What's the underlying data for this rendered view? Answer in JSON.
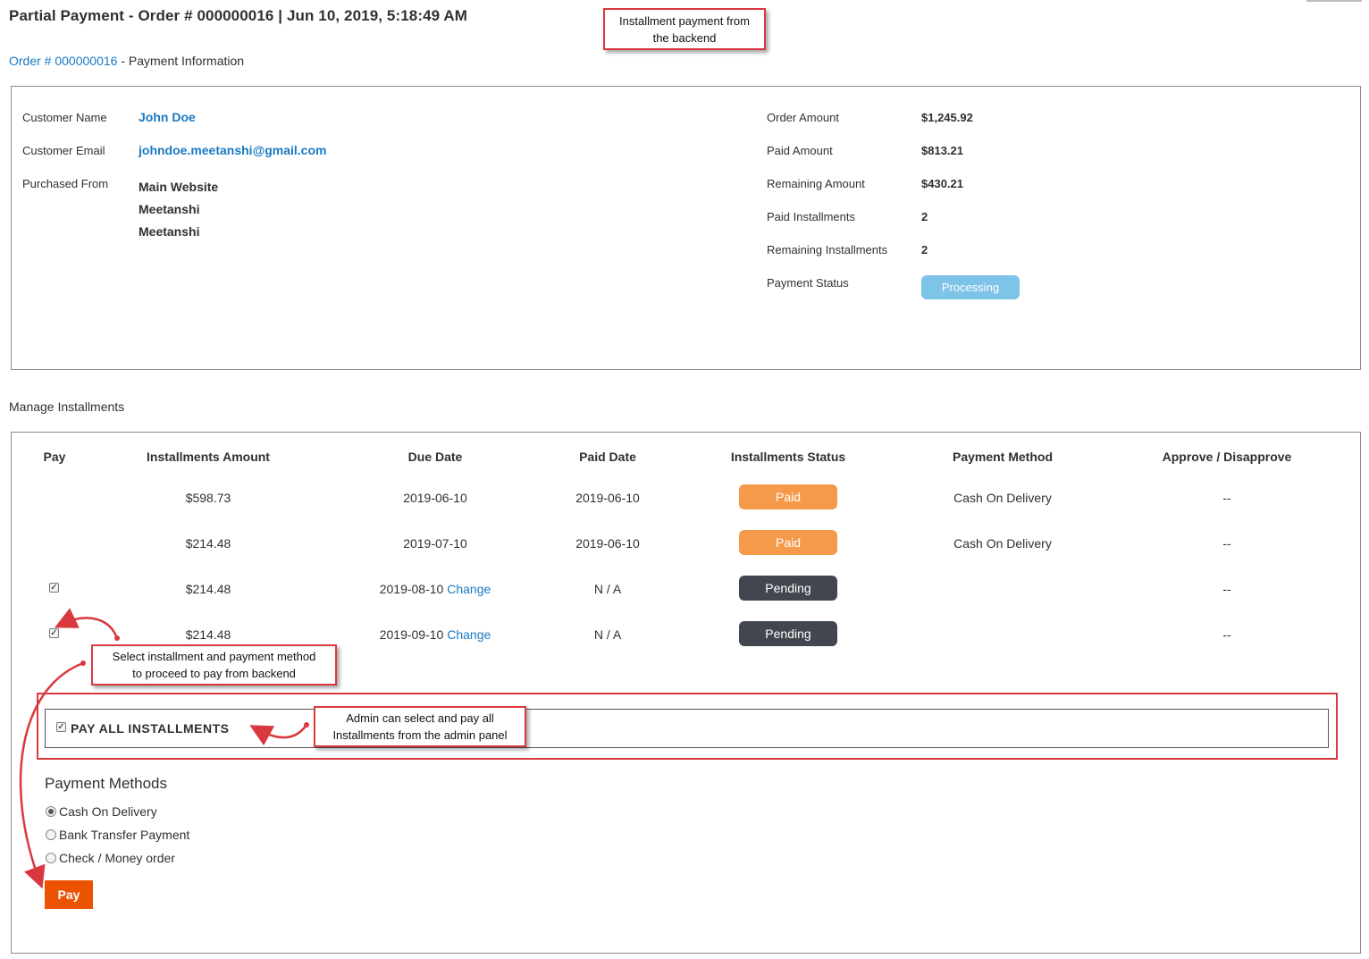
{
  "header": {
    "title": "Partial Payment - Order # 000000016 | Jun 10, 2019, 5:18:49 AM",
    "order_link": "Order # 000000016",
    "subtitle_suffix": " - Payment Information"
  },
  "customer": {
    "name_label": "Customer Name",
    "name": "John Doe",
    "email_label": "Customer Email",
    "email": "johndoe.meetanshi@gmail.com",
    "purchased_label": "Purchased From",
    "purchased": [
      "Main Website",
      "Meetanshi",
      "Meetanshi"
    ]
  },
  "summary": {
    "order_amount_label": "Order Amount",
    "order_amount": "$1,245.92",
    "paid_amount_label": "Paid Amount",
    "paid_amount": "$813.21",
    "remaining_amount_label": "Remaining Amount",
    "remaining_amount": "$430.21",
    "paid_installments_label": "Paid Installments",
    "paid_installments": "2",
    "remaining_installments_label": "Remaining Installments",
    "remaining_installments": "2",
    "payment_status_label": "Payment Status",
    "payment_status": "Processing"
  },
  "installments": {
    "section_title": "Manage Installments",
    "columns": [
      "Pay",
      "Installments Amount",
      "Due Date",
      "Paid Date",
      "Installments Status",
      "Payment Method",
      "Approve / Disapprove"
    ],
    "change_label": "Change",
    "rows": [
      {
        "amount": "$598.73",
        "due": "2019-06-10",
        "paid": "2019-06-10",
        "status": "Paid",
        "method": "Cash On Delivery",
        "approve": "--"
      },
      {
        "amount": "$214.48",
        "due": "2019-07-10",
        "paid": "2019-06-10",
        "status": "Paid",
        "method": "Cash On Delivery",
        "approve": "--"
      },
      {
        "amount": "$214.48",
        "due": "2019-08-10",
        "paid": "N / A",
        "status": "Pending",
        "method": "",
        "approve": "--"
      },
      {
        "amount": "$214.48",
        "due": "2019-09-10",
        "paid": "N / A",
        "status": "Pending",
        "method": "",
        "approve": "--"
      }
    ],
    "pay_all_label": "PAY ALL INSTALLMENTS"
  },
  "payment_methods": {
    "title": "Payment Methods",
    "options": [
      "Cash On Delivery",
      "Bank Transfer Payment",
      "Check / Money order"
    ],
    "selected": "Cash On Delivery",
    "pay_button": "Pay"
  },
  "annotations": {
    "backend_note_1": "Installment payment from",
    "backend_note_2": "the backend",
    "select_note_1": "Select installment and payment method",
    "select_note_2": "to proceed to pay from backend",
    "admin_note_1": "Admin can select and pay all",
    "admin_note_2": "Installments from the admin panel"
  },
  "colors": {
    "link": "#1979c3",
    "paid_badge": "#f59a4a",
    "pending_badge": "#41464f",
    "processing_badge": "#7ec3e8",
    "pay_button": "#eb5202",
    "annotation_red": "#d9393e"
  }
}
